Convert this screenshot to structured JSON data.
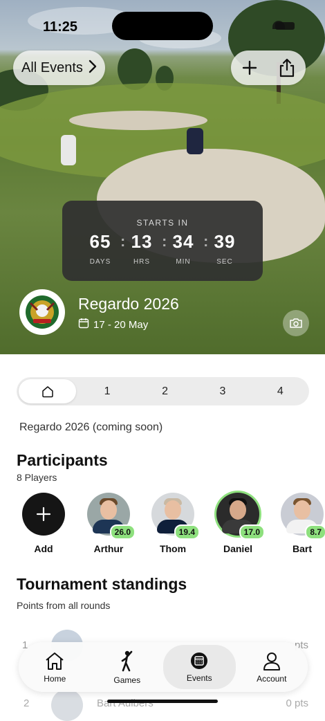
{
  "status_bar": {
    "time": "11:25"
  },
  "header": {
    "back_label": "All Events",
    "back_icon": "chevron-right-icon",
    "add_icon": "plus-icon",
    "share_icon": "share-icon"
  },
  "countdown": {
    "heading": "STARTS IN",
    "units": [
      {
        "value": "65",
        "label": "DAYS"
      },
      {
        "value": "13",
        "label": "HRS"
      },
      {
        "value": "34",
        "label": "MIN"
      },
      {
        "value": "39",
        "label": "SEC"
      }
    ]
  },
  "event": {
    "title": "Regardo 2026",
    "dates": "17 - 20 May"
  },
  "tabs": [
    {
      "label": "",
      "icon": "home-icon",
      "active": true
    },
    {
      "label": "1"
    },
    {
      "label": "2"
    },
    {
      "label": "3"
    },
    {
      "label": "4"
    }
  ],
  "description": "Regardo 2026 (coming soon)",
  "participants": {
    "title": "Participants",
    "count_label": "8 Players",
    "add_label": "Add",
    "players": [
      {
        "name": "Arthur",
        "handicap": "26.0"
      },
      {
        "name": "Thom",
        "handicap": "19.4"
      },
      {
        "name": "Daniel",
        "handicap": "17.0"
      },
      {
        "name": "Bart",
        "handicap": "8.7"
      }
    ]
  },
  "standings": {
    "title": "Tournament standings",
    "subtitle": "Points from all rounds",
    "rows": [
      {
        "rank": "1",
        "name": "",
        "points": "pts"
      },
      {
        "rank": "2",
        "name": "Bart Aulbers",
        "points": "0 pts"
      }
    ]
  },
  "nav": [
    {
      "label": "Home",
      "icon": "house-icon"
    },
    {
      "label": "Games",
      "icon": "golfer-icon"
    },
    {
      "label": "Events",
      "icon": "calendar-icon",
      "active": true
    },
    {
      "label": "Account",
      "icon": "person-icon"
    }
  ]
}
